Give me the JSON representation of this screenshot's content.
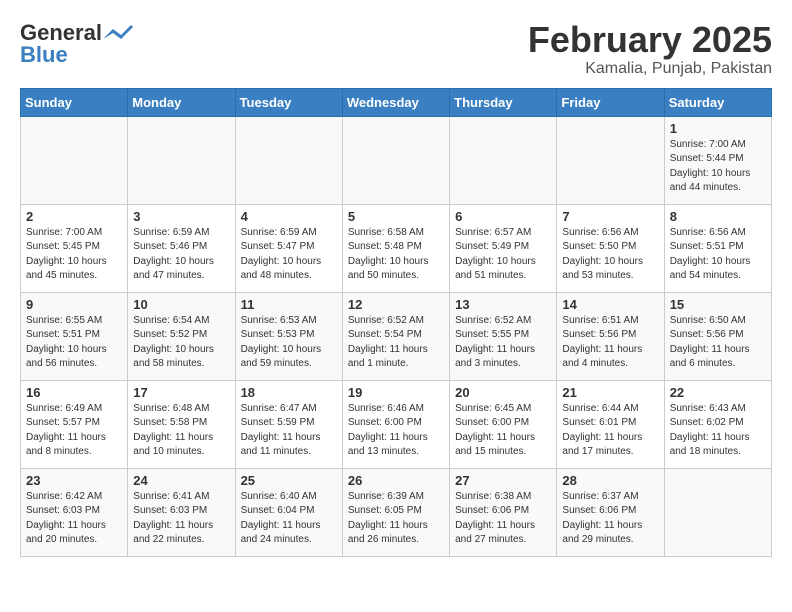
{
  "header": {
    "logo_general": "General",
    "logo_blue": "Blue",
    "month_title": "February 2025",
    "location": "Kamalia, Punjab, Pakistan"
  },
  "days_of_week": [
    "Sunday",
    "Monday",
    "Tuesday",
    "Wednesday",
    "Thursday",
    "Friday",
    "Saturday"
  ],
  "weeks": [
    [
      {
        "day": "",
        "info": ""
      },
      {
        "day": "",
        "info": ""
      },
      {
        "day": "",
        "info": ""
      },
      {
        "day": "",
        "info": ""
      },
      {
        "day": "",
        "info": ""
      },
      {
        "day": "",
        "info": ""
      },
      {
        "day": "1",
        "info": "Sunrise: 7:00 AM\nSunset: 5:44 PM\nDaylight: 10 hours and 44 minutes."
      }
    ],
    [
      {
        "day": "2",
        "info": "Sunrise: 7:00 AM\nSunset: 5:45 PM\nDaylight: 10 hours and 45 minutes."
      },
      {
        "day": "3",
        "info": "Sunrise: 6:59 AM\nSunset: 5:46 PM\nDaylight: 10 hours and 47 minutes."
      },
      {
        "day": "4",
        "info": "Sunrise: 6:59 AM\nSunset: 5:47 PM\nDaylight: 10 hours and 48 minutes."
      },
      {
        "day": "5",
        "info": "Sunrise: 6:58 AM\nSunset: 5:48 PM\nDaylight: 10 hours and 50 minutes."
      },
      {
        "day": "6",
        "info": "Sunrise: 6:57 AM\nSunset: 5:49 PM\nDaylight: 10 hours and 51 minutes."
      },
      {
        "day": "7",
        "info": "Sunrise: 6:56 AM\nSunset: 5:50 PM\nDaylight: 10 hours and 53 minutes."
      },
      {
        "day": "8",
        "info": "Sunrise: 6:56 AM\nSunset: 5:51 PM\nDaylight: 10 hours and 54 minutes."
      }
    ],
    [
      {
        "day": "9",
        "info": "Sunrise: 6:55 AM\nSunset: 5:51 PM\nDaylight: 10 hours and 56 minutes."
      },
      {
        "day": "10",
        "info": "Sunrise: 6:54 AM\nSunset: 5:52 PM\nDaylight: 10 hours and 58 minutes."
      },
      {
        "day": "11",
        "info": "Sunrise: 6:53 AM\nSunset: 5:53 PM\nDaylight: 10 hours and 59 minutes."
      },
      {
        "day": "12",
        "info": "Sunrise: 6:52 AM\nSunset: 5:54 PM\nDaylight: 11 hours and 1 minute."
      },
      {
        "day": "13",
        "info": "Sunrise: 6:52 AM\nSunset: 5:55 PM\nDaylight: 11 hours and 3 minutes."
      },
      {
        "day": "14",
        "info": "Sunrise: 6:51 AM\nSunset: 5:56 PM\nDaylight: 11 hours and 4 minutes."
      },
      {
        "day": "15",
        "info": "Sunrise: 6:50 AM\nSunset: 5:56 PM\nDaylight: 11 hours and 6 minutes."
      }
    ],
    [
      {
        "day": "16",
        "info": "Sunrise: 6:49 AM\nSunset: 5:57 PM\nDaylight: 11 hours and 8 minutes."
      },
      {
        "day": "17",
        "info": "Sunrise: 6:48 AM\nSunset: 5:58 PM\nDaylight: 11 hours and 10 minutes."
      },
      {
        "day": "18",
        "info": "Sunrise: 6:47 AM\nSunset: 5:59 PM\nDaylight: 11 hours and 11 minutes."
      },
      {
        "day": "19",
        "info": "Sunrise: 6:46 AM\nSunset: 6:00 PM\nDaylight: 11 hours and 13 minutes."
      },
      {
        "day": "20",
        "info": "Sunrise: 6:45 AM\nSunset: 6:00 PM\nDaylight: 11 hours and 15 minutes."
      },
      {
        "day": "21",
        "info": "Sunrise: 6:44 AM\nSunset: 6:01 PM\nDaylight: 11 hours and 17 minutes."
      },
      {
        "day": "22",
        "info": "Sunrise: 6:43 AM\nSunset: 6:02 PM\nDaylight: 11 hours and 18 minutes."
      }
    ],
    [
      {
        "day": "23",
        "info": "Sunrise: 6:42 AM\nSunset: 6:03 PM\nDaylight: 11 hours and 20 minutes."
      },
      {
        "day": "24",
        "info": "Sunrise: 6:41 AM\nSunset: 6:03 PM\nDaylight: 11 hours and 22 minutes."
      },
      {
        "day": "25",
        "info": "Sunrise: 6:40 AM\nSunset: 6:04 PM\nDaylight: 11 hours and 24 minutes."
      },
      {
        "day": "26",
        "info": "Sunrise: 6:39 AM\nSunset: 6:05 PM\nDaylight: 11 hours and 26 minutes."
      },
      {
        "day": "27",
        "info": "Sunrise: 6:38 AM\nSunset: 6:06 PM\nDaylight: 11 hours and 27 minutes."
      },
      {
        "day": "28",
        "info": "Sunrise: 6:37 AM\nSunset: 6:06 PM\nDaylight: 11 hours and 29 minutes."
      },
      {
        "day": "",
        "info": ""
      }
    ]
  ]
}
